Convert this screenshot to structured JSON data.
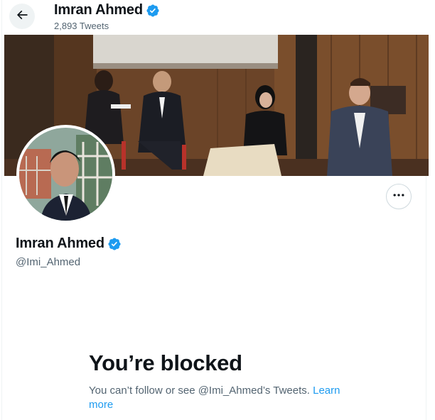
{
  "header": {
    "back_icon": "arrow-left-icon",
    "name": "Imran Ahmed",
    "tweet_count": "2,893 Tweets",
    "verified_icon": "verified-badge-icon"
  },
  "profile": {
    "name": "Imran Ahmed",
    "handle": "@Imi_Ahmed",
    "more_icon": "more-options-icon"
  },
  "blocked": {
    "title": "You’re blocked",
    "message": "You can’t follow or see @Imi_Ahmed’s Tweets.",
    "learn_more": "Learn more"
  },
  "colors": {
    "accent": "#1d9bf0",
    "text_primary": "#0f1419",
    "text_secondary": "#536471"
  }
}
